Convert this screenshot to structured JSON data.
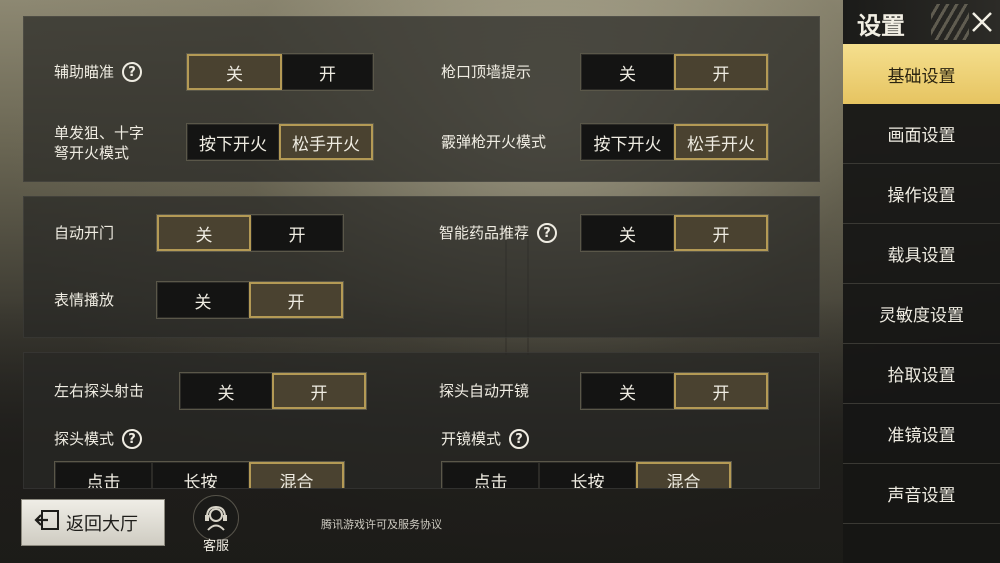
{
  "basic": {
    "aim_assist": {
      "label": "辅助瞄准",
      "off": "关",
      "on": "开",
      "selected": "off"
    },
    "muzzle_wall": {
      "label": "枪口顶墙提示",
      "off": "关",
      "on": "开",
      "selected": "on"
    },
    "sniper_fire": {
      "label_line1": "单发狙、十字",
      "label_line2": "弩开火模式",
      "opt1": "按下开火",
      "opt2": "松手开火",
      "selected": "opt2"
    },
    "shotgun_fire": {
      "label": "霰弹枪开火模式",
      "opt1": "按下开火",
      "opt2": "松手开火",
      "selected": "opt2"
    },
    "auto_door": {
      "label": "自动开门",
      "off": "关",
      "on": "开",
      "selected": "off"
    },
    "med_recommend": {
      "label": "智能药品推荐",
      "off": "关",
      "on": "开",
      "selected": "on"
    },
    "emote_play": {
      "label": "表情播放",
      "off": "关",
      "on": "开",
      "selected": "on"
    },
    "peek_fire": {
      "label": "左右探头射击",
      "off": "关",
      "on": "开",
      "selected": "on"
    },
    "peek_auto_scope": {
      "label": "探头自动开镜",
      "off": "关",
      "on": "开",
      "selected": "on"
    },
    "peek_mode": {
      "label": "探头模式",
      "options": [
        "点击",
        "长按",
        "混合"
      ],
      "selected": 2
    },
    "scope_mode": {
      "label": "开镜模式",
      "options": [
        "点击",
        "长按",
        "混合"
      ],
      "selected": 2
    }
  },
  "sidebar": {
    "title": "设置",
    "items": [
      "基础设置",
      "画面设置",
      "操作设置",
      "载具设置",
      "灵敏度设置",
      "拾取设置",
      "准镜设置",
      "声音设置"
    ],
    "active": 0
  },
  "footer": {
    "back_label": "返回大厅",
    "cs_label": "客服",
    "license": "腾讯游戏许可及服务协议"
  },
  "colors": {
    "accent_gold": "#b49a55",
    "active_menu": "#f0d37a",
    "on_fill": "#4a4230"
  }
}
